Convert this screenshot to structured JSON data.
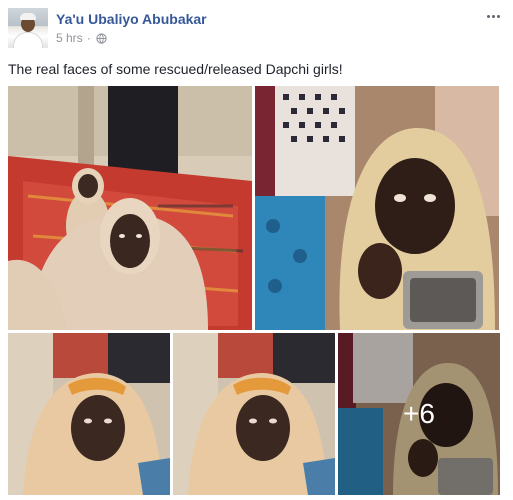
{
  "post": {
    "author": "Ya'u Ubaliyo Abubakar",
    "time": "5 hrs",
    "separator": "·",
    "privacy_icon": "globe-icon",
    "caption": "The real faces of some rescued/released Dapchi girls!",
    "more_options_icon": "more-horizontal-icon"
  },
  "photos": {
    "remaining_count": "+6"
  }
}
